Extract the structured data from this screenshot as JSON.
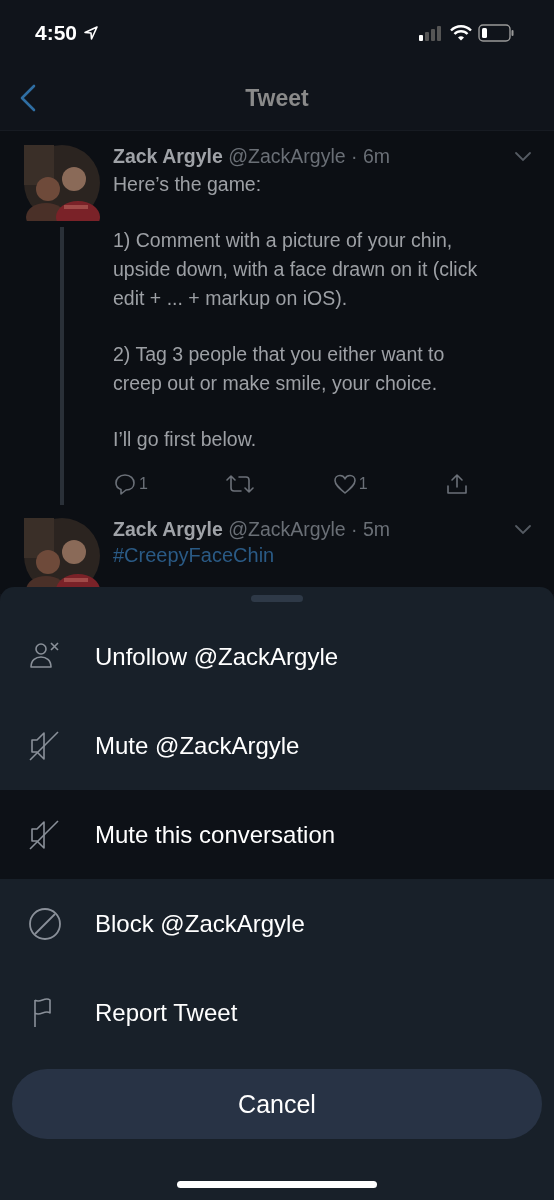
{
  "status_bar": {
    "time": "4:50"
  },
  "nav": {
    "title": "Tweet"
  },
  "tweets": [
    {
      "name": "Zack Argyle",
      "handle": "@ZackArgyle",
      "time": "· 6m",
      "paragraphs": [
        "Here’s the game:",
        "1) Comment with a picture of your chin, upside down, with a face drawn on it (click edit + ... + markup on iOS).",
        "2) Tag 3 people that you either want to creep out or make smile, your choice.",
        "I’ll go first below."
      ],
      "actions": {
        "replies": "1",
        "likes": "1"
      }
    },
    {
      "name": "Zack Argyle",
      "handle": "@ZackArgyle",
      "time": "· 5m",
      "hashtag": "#CreepyFaceChin"
    }
  ],
  "sheet": {
    "items": [
      {
        "kind": "unfollow",
        "label": "Unfollow @ZackArgyle",
        "selected": false
      },
      {
        "kind": "mute",
        "label": "Mute @ZackArgyle",
        "selected": false
      },
      {
        "kind": "mute",
        "label": "Mute this conversation",
        "selected": true
      },
      {
        "kind": "block",
        "label": "Block @ZackArgyle",
        "selected": false
      },
      {
        "kind": "report",
        "label": "Report Tweet",
        "selected": false
      }
    ],
    "cancel": "Cancel"
  }
}
